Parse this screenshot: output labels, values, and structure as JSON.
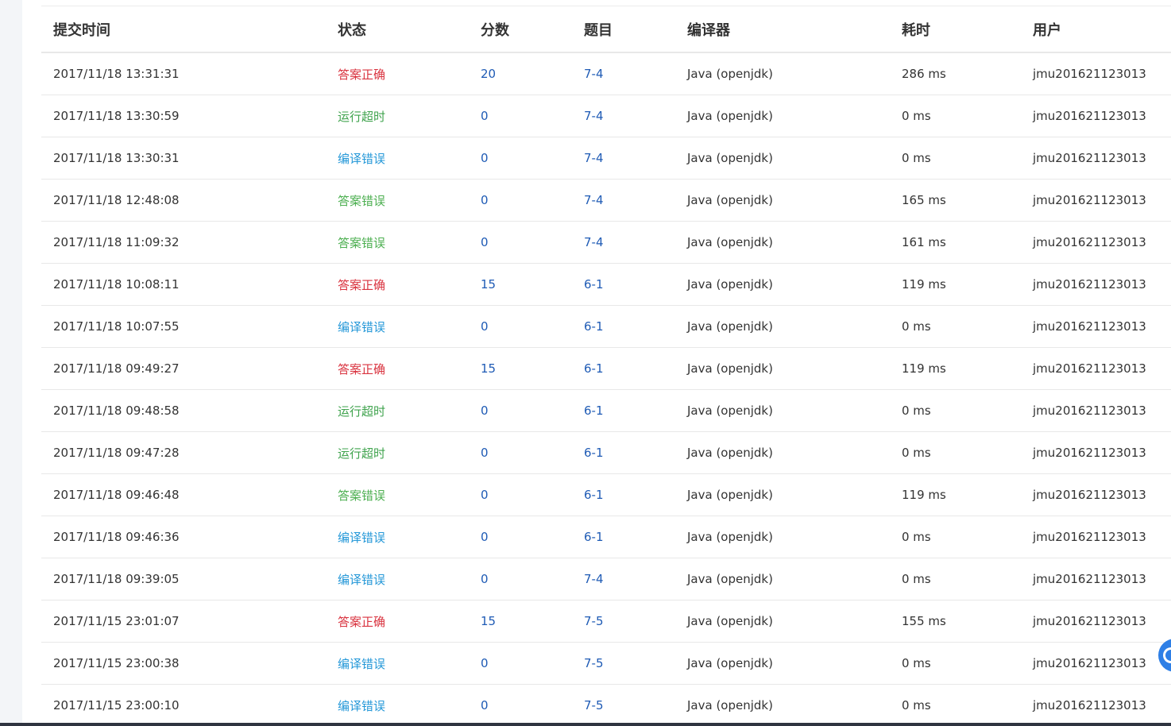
{
  "table": {
    "headers": [
      "提交时间",
      "状态",
      "分数",
      "题目",
      "编译器",
      "耗时",
      "用户"
    ],
    "rows": [
      {
        "time": "2017/11/18 13:31:31",
        "status": "答案正确",
        "status_type": "correct",
        "score": "20",
        "problem": "7-4",
        "compiler": "Java (openjdk)",
        "elapsed": "286 ms",
        "user": "jmu201621123013"
      },
      {
        "time": "2017/11/18 13:30:59",
        "status": "运行超时",
        "status_type": "tle",
        "score": "0",
        "problem": "7-4",
        "compiler": "Java (openjdk)",
        "elapsed": "0 ms",
        "user": "jmu201621123013"
      },
      {
        "time": "2017/11/18 13:30:31",
        "status": "编译错误",
        "status_type": "ce",
        "score": "0",
        "problem": "7-4",
        "compiler": "Java (openjdk)",
        "elapsed": "0 ms",
        "user": "jmu201621123013"
      },
      {
        "time": "2017/11/18 12:48:08",
        "status": "答案错误",
        "status_type": "wa",
        "score": "0",
        "problem": "7-4",
        "compiler": "Java (openjdk)",
        "elapsed": "165 ms",
        "user": "jmu201621123013"
      },
      {
        "time": "2017/11/18 11:09:32",
        "status": "答案错误",
        "status_type": "wa",
        "score": "0",
        "problem": "7-4",
        "compiler": "Java (openjdk)",
        "elapsed": "161 ms",
        "user": "jmu201621123013"
      },
      {
        "time": "2017/11/18 10:08:11",
        "status": "答案正确",
        "status_type": "correct",
        "score": "15",
        "problem": "6-1",
        "compiler": "Java (openjdk)",
        "elapsed": "119 ms",
        "user": "jmu201621123013"
      },
      {
        "time": "2017/11/18 10:07:55",
        "status": "编译错误",
        "status_type": "ce",
        "score": "0",
        "problem": "6-1",
        "compiler": "Java (openjdk)",
        "elapsed": "0 ms",
        "user": "jmu201621123013"
      },
      {
        "time": "2017/11/18 09:49:27",
        "status": "答案正确",
        "status_type": "correct",
        "score": "15",
        "problem": "6-1",
        "compiler": "Java (openjdk)",
        "elapsed": "119 ms",
        "user": "jmu201621123013"
      },
      {
        "time": "2017/11/18 09:48:58",
        "status": "运行超时",
        "status_type": "tle",
        "score": "0",
        "problem": "6-1",
        "compiler": "Java (openjdk)",
        "elapsed": "0 ms",
        "user": "jmu201621123013"
      },
      {
        "time": "2017/11/18 09:47:28",
        "status": "运行超时",
        "status_type": "tle",
        "score": "0",
        "problem": "6-1",
        "compiler": "Java (openjdk)",
        "elapsed": "0 ms",
        "user": "jmu201621123013"
      },
      {
        "time": "2017/11/18 09:46:48",
        "status": "答案错误",
        "status_type": "wa",
        "score": "0",
        "problem": "6-1",
        "compiler": "Java (openjdk)",
        "elapsed": "119 ms",
        "user": "jmu201621123013"
      },
      {
        "time": "2017/11/18 09:46:36",
        "status": "编译错误",
        "status_type": "ce",
        "score": "0",
        "problem": "6-1",
        "compiler": "Java (openjdk)",
        "elapsed": "0 ms",
        "user": "jmu201621123013"
      },
      {
        "time": "2017/11/18 09:39:05",
        "status": "编译错误",
        "status_type": "ce",
        "score": "0",
        "problem": "7-4",
        "compiler": "Java (openjdk)",
        "elapsed": "0 ms",
        "user": "jmu201621123013"
      },
      {
        "time": "2017/11/15 23:01:07",
        "status": "答案正确",
        "status_type": "correct",
        "score": "15",
        "problem": "7-5",
        "compiler": "Java (openjdk)",
        "elapsed": "155 ms",
        "user": "jmu201621123013"
      },
      {
        "time": "2017/11/15 23:00:38",
        "status": "编译错误",
        "status_type": "ce",
        "score": "0",
        "problem": "7-5",
        "compiler": "Java (openjdk)",
        "elapsed": "0 ms",
        "user": "jmu201621123013"
      },
      {
        "time": "2017/11/15 23:00:10",
        "status": "编译错误",
        "status_type": "ce",
        "score": "0",
        "problem": "7-5",
        "compiler": "Java (openjdk)",
        "elapsed": "0 ms",
        "user": "jmu201621123013"
      }
    ]
  },
  "colors": {
    "correct": "#d9333f",
    "tle": "#3fa34d",
    "ce": "#2598d8",
    "wa": "#4caf50",
    "link": "#1f5bb5"
  },
  "icons": {
    "floating_button": "refresh-icon"
  }
}
